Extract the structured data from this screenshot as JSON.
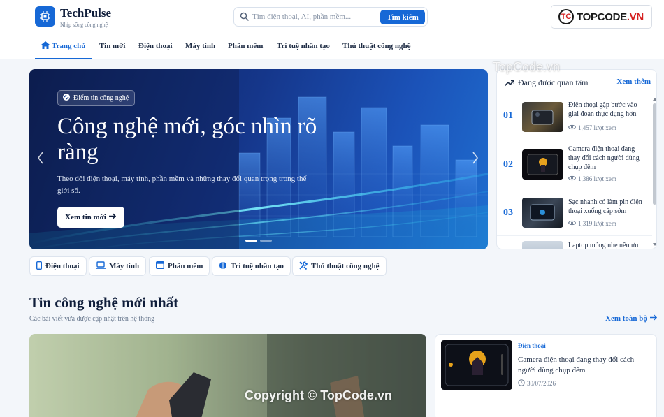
{
  "header": {
    "brand": "TechPulse",
    "tagline": "Nhịp sống công nghệ",
    "search_placeholder": "Tìm điện thoại, AI, phần mềm...",
    "search_button": "Tìm kiếm",
    "watermark_logo_badge": "TC",
    "watermark_logo_text_a": "TOPCODE",
    "watermark_logo_text_b": ".VN"
  },
  "nav": [
    {
      "label": "Trang chủ",
      "active": true
    },
    {
      "label": "Tin mới"
    },
    {
      "label": "Điện thoại"
    },
    {
      "label": "Máy tính"
    },
    {
      "label": "Phần mềm"
    },
    {
      "label": "Trí tuệ nhân tạo"
    },
    {
      "label": "Thủ thuật công nghệ"
    }
  ],
  "hero": {
    "badge": "Điểm tin công nghệ",
    "title": "Công nghệ mới, góc nhìn rõ ràng",
    "description": "Theo dõi điện thoại, máy tính, phần mềm và những thay đổi quan trọng trong thế giới số.",
    "button": "Xem tin mới",
    "slides": 2,
    "active_slide": 1
  },
  "trending": {
    "title": "Đang được quan tâm",
    "more": "Xem thêm",
    "items": [
      {
        "rank": "01",
        "title": "Điện thoại gập bước vào giai đoạn thực dụng hơn",
        "views": "1,457 lượt xem"
      },
      {
        "rank": "02",
        "title": "Camera điện thoại đang thay đổi cách người dùng chụp đêm",
        "views": "1,386 lượt xem"
      },
      {
        "rank": "03",
        "title": "Sạc nhanh có làm pin điện thoại xuống cấp sớm",
        "views": "1,319 lượt xem"
      },
      {
        "rank": "04",
        "title": "Laptop mỏng nhẹ nên ưu",
        "views": ""
      }
    ]
  },
  "categories": [
    {
      "label": "Điện thoại",
      "icon": "phone-icon"
    },
    {
      "label": "Máy tính",
      "icon": "laptop-icon"
    },
    {
      "label": "Phần mềm",
      "icon": "window-icon"
    },
    {
      "label": "Trí tuệ nhân tạo",
      "icon": "brain-icon"
    },
    {
      "label": "Thủ thuật công nghệ",
      "icon": "tools-icon"
    }
  ],
  "latest": {
    "title": "Tin công nghệ mới nhất",
    "subtitle": "Các bài viết vừa được cập nhật trên hệ thống",
    "view_all": "Xem toàn bộ",
    "side_card": {
      "category": "Điện thoại",
      "title": "Camera điện thoại đang thay đổi cách người dùng chụp đêm",
      "date": "30/07/2026"
    }
  },
  "watermarks": {
    "top": "TopCode.vn",
    "bottom": "Copyright © TopCode.vn"
  },
  "colors": {
    "accent": "#1668d6",
    "text": "#0f1d3a",
    "background": "#f3f6fa"
  }
}
